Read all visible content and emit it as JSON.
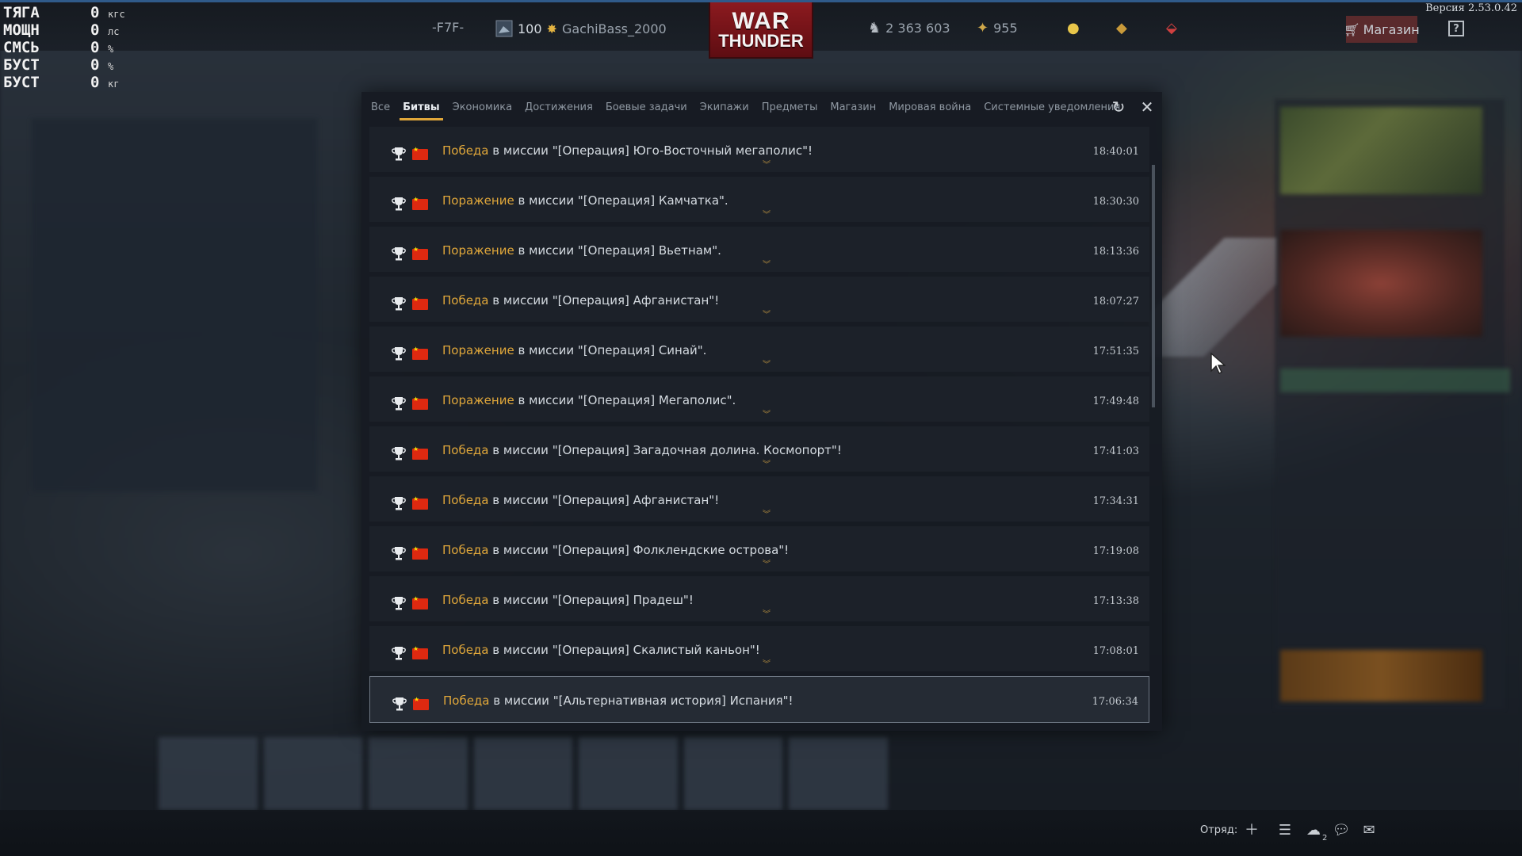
{
  "version": "Версия 2.53.0.42",
  "hud": [
    {
      "label": "ТЯГА",
      "value": "0",
      "unit": "кгс"
    },
    {
      "label": "МОЩН",
      "value": "0",
      "unit": "лс"
    },
    {
      "label": "СМСЬ",
      "value": "0",
      "unit": "%"
    },
    {
      "label": "БУСТ",
      "value": "0",
      "unit": "%"
    },
    {
      "label": "БУСТ",
      "value": "0",
      "unit": "кг"
    }
  ],
  "topbar": {
    "squad_tag": "-F7F-",
    "level": "100",
    "nickname": "GachiBass_2000",
    "logo_line1": "WAR",
    "logo_line2": "THUNDER",
    "silver_lions": "2 363 603",
    "golden_eagles": "955",
    "shop_label": "Магазин",
    "help_label": "?"
  },
  "dialog": {
    "tabs": [
      "Все",
      "Битвы",
      "Экономика",
      "Достижения",
      "Боевые задачи",
      "Экипажи",
      "Предметы",
      "Магазин",
      "Мировая война",
      "Системные уведомления"
    ],
    "active_tab": "Битвы",
    "mission_prefix": "в миссии",
    "rows": [
      {
        "result": "Победа",
        "text": " в миссии \"[Операция] Юго-Восточный мегаполис\"!",
        "time": "18:40:01"
      },
      {
        "result": "Поражение",
        "text": " в миссии \"[Операция] Камчатка\".",
        "time": "18:30:30"
      },
      {
        "result": "Поражение",
        "text": " в миссии \"[Операция] Вьетнам\".",
        "time": "18:13:36"
      },
      {
        "result": "Победа",
        "text": " в миссии \"[Операция] Афганистан\"!",
        "time": "18:07:27"
      },
      {
        "result": "Поражение",
        "text": " в миссии \"[Операция] Синай\".",
        "time": "17:51:35"
      },
      {
        "result": "Поражение",
        "text": " в миссии \"[Операция] Мегаполис\".",
        "time": "17:49:48"
      },
      {
        "result": "Победа",
        "text": " в миссии \"[Операция] Загадочная долина. Космопорт\"!",
        "time": "17:41:03"
      },
      {
        "result": "Победа",
        "text": " в миссии \"[Операция] Афганистан\"!",
        "time": "17:34:31"
      },
      {
        "result": "Победа",
        "text": " в миссии \"[Операция] Фолклендские острова\"!",
        "time": "17:19:08"
      },
      {
        "result": "Победа",
        "text": " в миссии \"[Операция] Прадеш\"!",
        "time": "17:13:38"
      },
      {
        "result": "Победа",
        "text": " в миссии \"[Операция] Скалистый каньон\"!",
        "time": "17:08:01"
      },
      {
        "result": "Победа",
        "text": " в миссии \"[Альтернативная история] Испания\"!",
        "time": "17:06:34"
      }
    ]
  },
  "bottombar": {
    "squad_label": "Отряд:",
    "friends_count": "2"
  },
  "colors": {
    "accent": "#e0a73a",
    "flag_red": "#de2910",
    "logo_red": "#8c1a1f",
    "top_border": "#2f5a8a"
  }
}
